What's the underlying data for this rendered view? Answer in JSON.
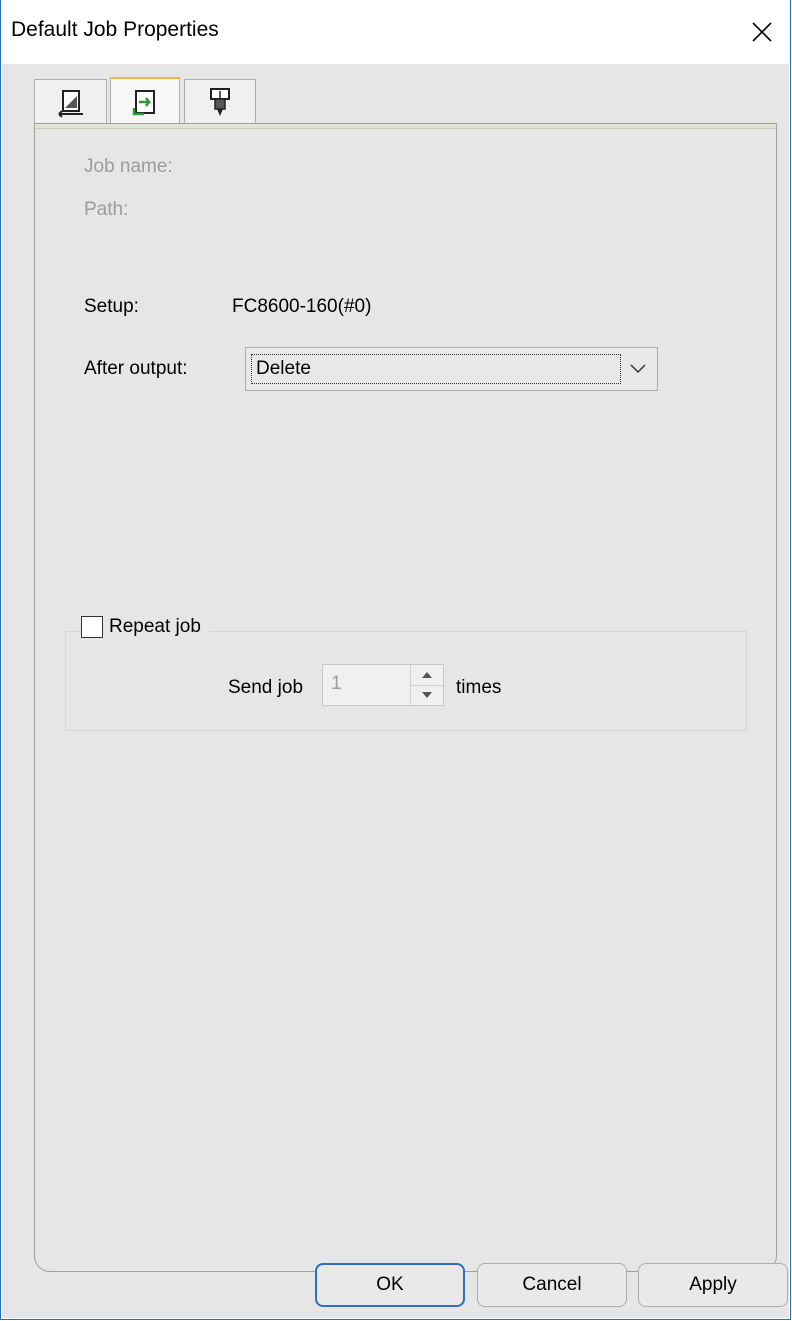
{
  "window": {
    "title": "Default Job Properties"
  },
  "tabs": [
    {
      "icon": "page-layout-icon",
      "selected": false
    },
    {
      "icon": "output-arrow-icon",
      "selected": true
    },
    {
      "icon": "print-head-icon",
      "selected": false
    }
  ],
  "job": {
    "job_name_label": "Job name:",
    "path_label": "Path:"
  },
  "setup": {
    "label": "Setup:",
    "value": "FC8600-160(#0)"
  },
  "after_output": {
    "label": "After output:",
    "selected": "Delete"
  },
  "repeat": {
    "checkbox_label": "Repeat job",
    "checked": false,
    "send_label": "Send job",
    "count": "1",
    "times_label": "times"
  },
  "buttons": {
    "ok": "OK",
    "cancel": "Cancel",
    "apply": "Apply"
  },
  "colors": {
    "accent_tab": "#f5b942",
    "default_button_border": "#2d6fc0",
    "frame": "#2b6cc4"
  }
}
